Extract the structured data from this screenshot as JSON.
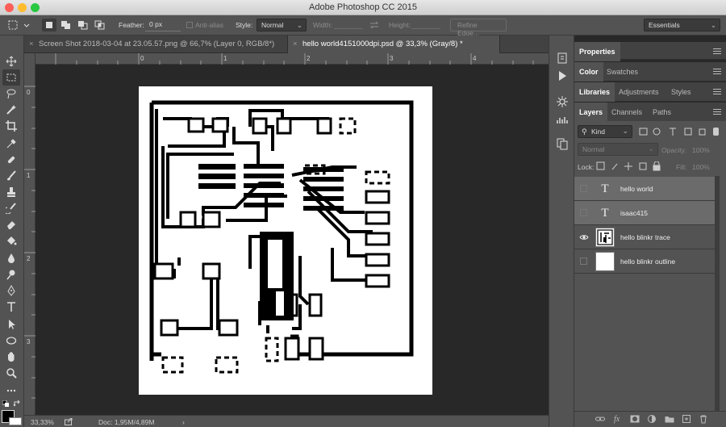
{
  "app_title": "Adobe Photoshop CC 2015",
  "options": {
    "feather_label": "Feather:",
    "feather_value": "0 px",
    "anti_alias": "Anti-alias",
    "style_label": "Style:",
    "style_value": "Normal",
    "width_label": "Width:",
    "height_label": "Height:",
    "refine_edge": "Refine Edge...",
    "workspace": "Essentials"
  },
  "doc_tabs": [
    {
      "label": "Screen Shot 2018-03-04 at 23.05.57.png @ 66,7% (Layer 0, RGB/8*)",
      "close": "×"
    },
    {
      "label": "hello world4151000dpi.psd @ 33,3% (Gray/8) *",
      "close": "×"
    }
  ],
  "ruler": {
    "h": [
      "0",
      "1",
      "2",
      "3",
      "4"
    ],
    "v": [
      "0",
      "1",
      "2",
      "3"
    ]
  },
  "status": {
    "zoom": "33,33%",
    "doc": "Doc: 1,95M/4,89M",
    "arrow": "›"
  },
  "panels": {
    "properties": "Properties",
    "color": "Color",
    "swatches": "Swatches",
    "libraries": "Libraries",
    "adjustments": "Adjustments",
    "styles": "Styles",
    "layers": "Layers",
    "channels": "Channels",
    "paths": "Paths"
  },
  "layers_panel": {
    "kind": "Kind",
    "blend": "Normal",
    "opacity_label": "Opacity:",
    "opacity_value": "100%",
    "lock_label": "Lock:",
    "fill_label": "Fill:",
    "fill_value": "100%",
    "items": [
      {
        "name": "hello world",
        "type": "T",
        "visible": false,
        "selected": true
      },
      {
        "name": "isaac415",
        "type": "T",
        "visible": false,
        "selected": true
      },
      {
        "name": "hello blinkr trace",
        "type": "image",
        "visible": true,
        "selected": false
      },
      {
        "name": "hello blinkr outline",
        "type": "image",
        "visible": false,
        "selected": false
      }
    ]
  },
  "footer_icons": [
    "link-icon",
    "fx-icon",
    "mask-icon",
    "adjustment-icon",
    "folder-icon",
    "new-layer-icon",
    "trash-icon"
  ]
}
